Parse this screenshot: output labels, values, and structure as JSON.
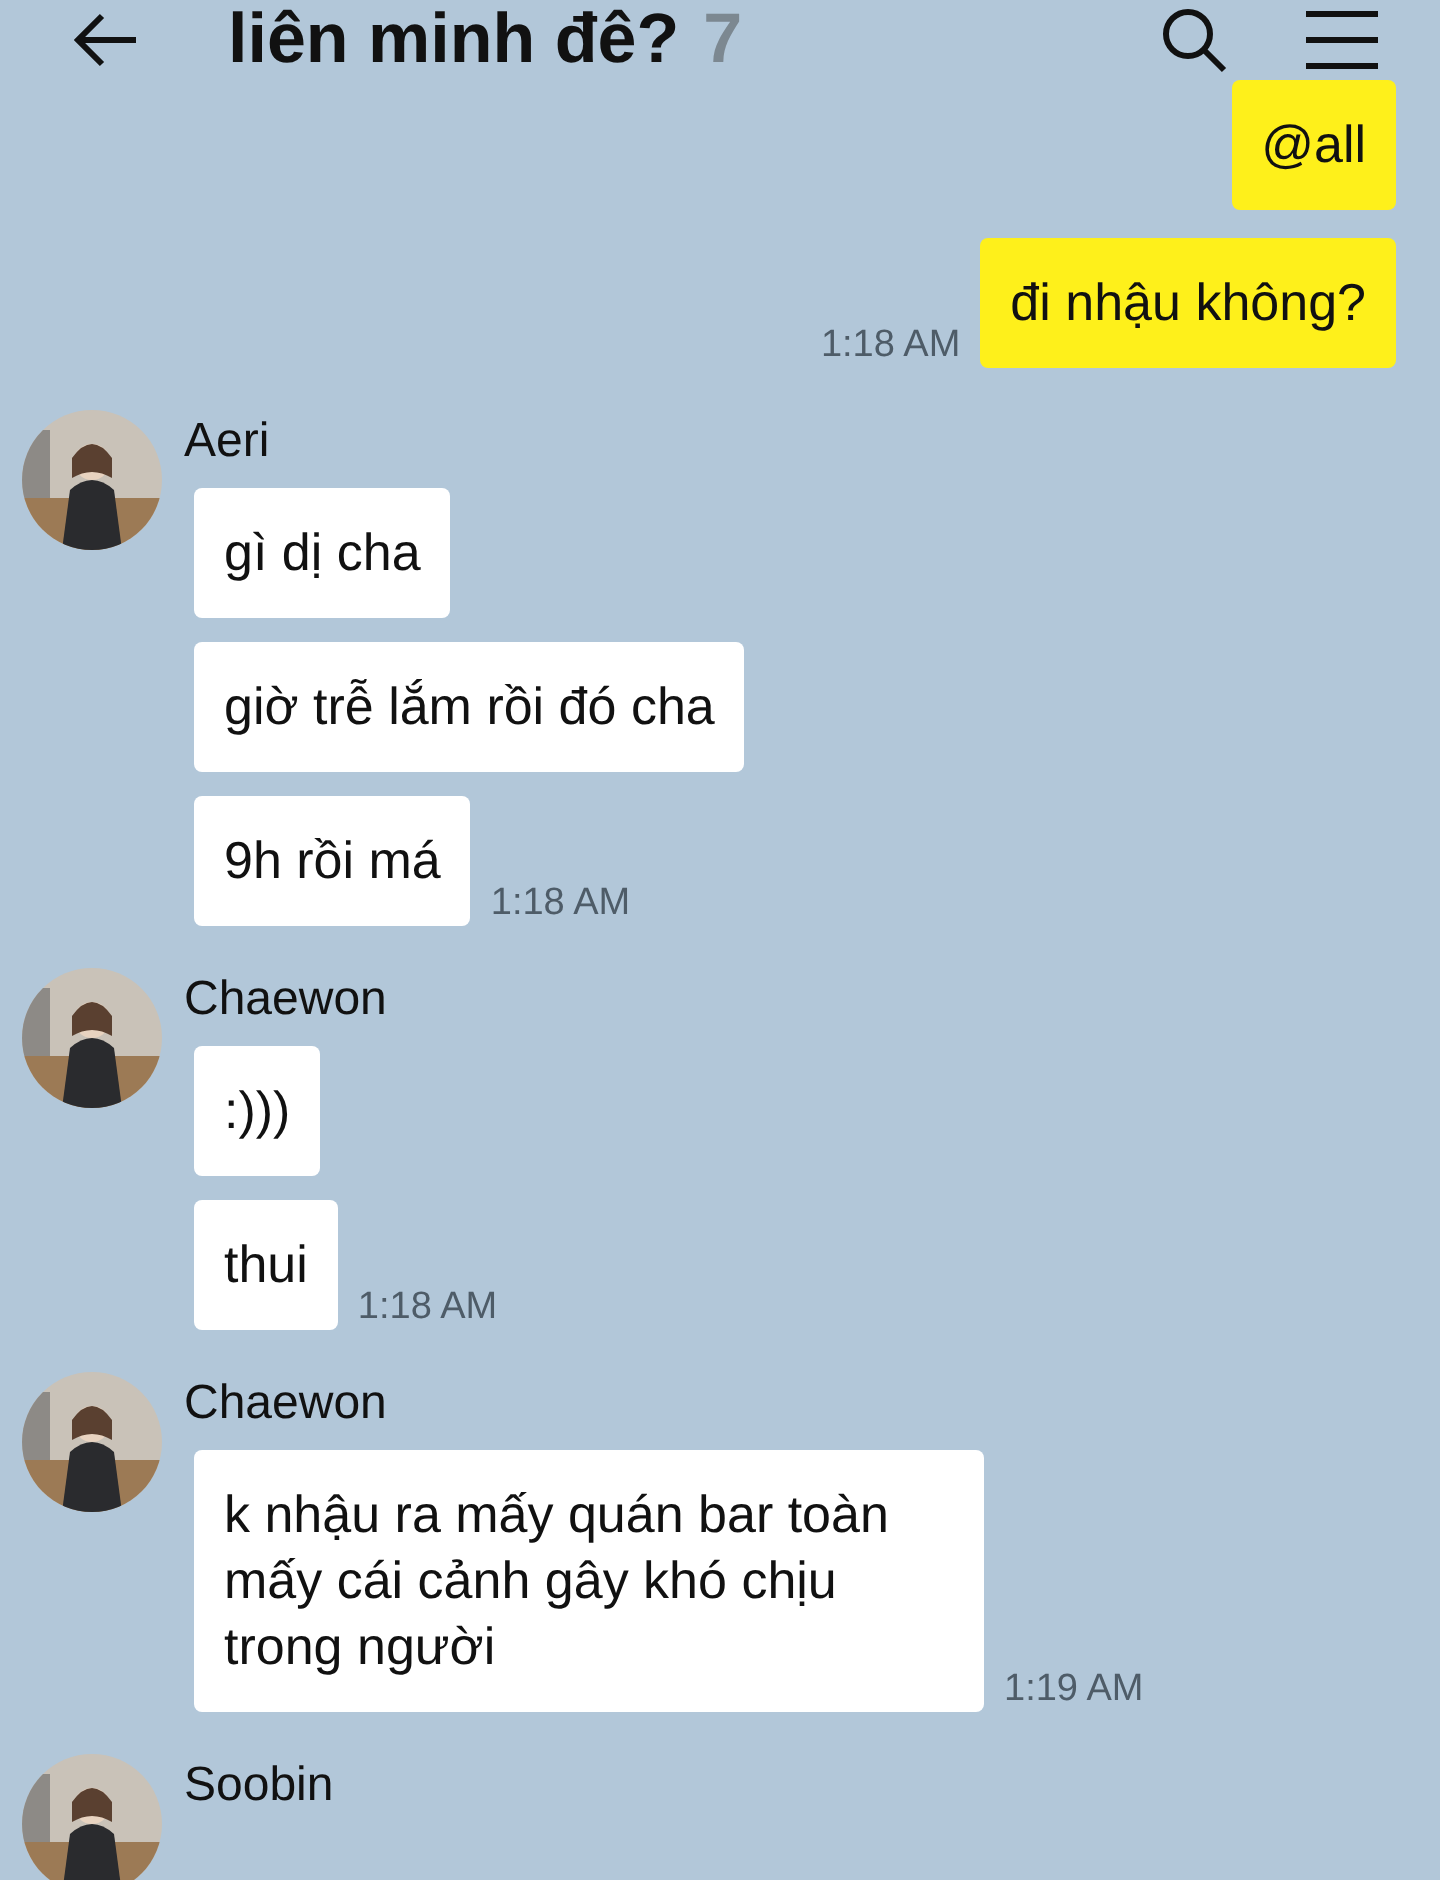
{
  "header": {
    "title": "liên minh đê?",
    "member_count": "7"
  },
  "messages": [
    {
      "kind": "outgoing",
      "bubbles": [
        "@all",
        "đi nhậu không?"
      ],
      "time": "1:18 AM"
    },
    {
      "kind": "incoming",
      "sender": "Aeri",
      "avatar": {
        "kind": "picture"
      },
      "bubbles": [
        "gì dị cha",
        "giờ trễ lắm rồi đó cha",
        "9h rồi má"
      ],
      "time": "1:18 AM"
    },
    {
      "kind": "incoming",
      "sender": "Chaewon",
      "avatar": {
        "kind": "picture"
      },
      "bubbles": [
        ":)))",
        "thui"
      ],
      "time": "1:18 AM"
    },
    {
      "kind": "incoming",
      "sender": "Chaewon",
      "avatar": {
        "kind": "picture"
      },
      "bubbles": [
        "k nhậu ra mấy quán bar toàn mấy cái cảnh gây khó chịu trong người"
      ],
      "time": "1:19 AM"
    },
    {
      "kind": "incoming",
      "sender": "Soobin",
      "avatar": {
        "kind": "picture"
      }
    }
  ]
}
